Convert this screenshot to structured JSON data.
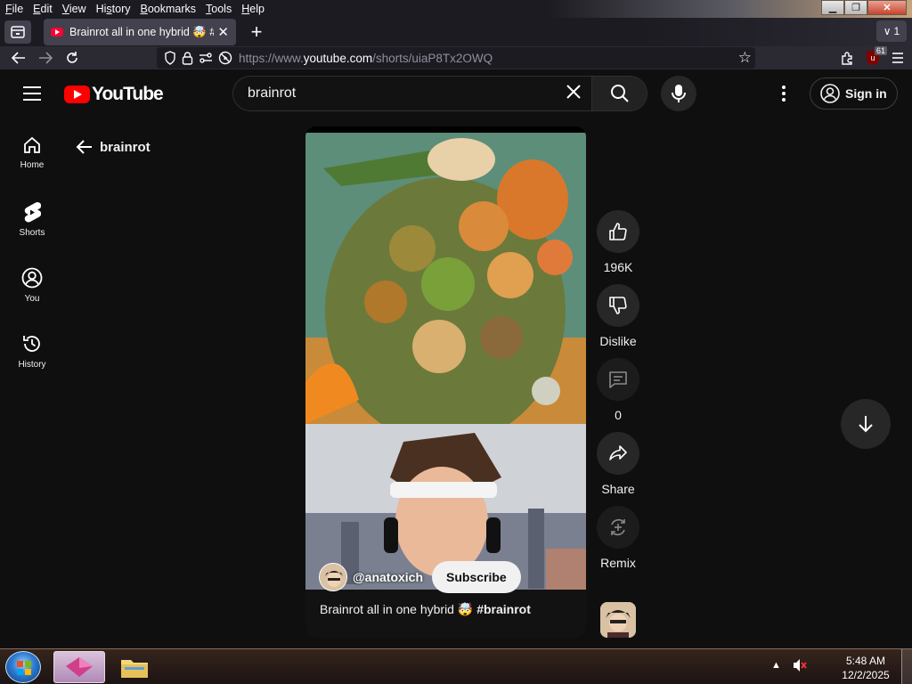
{
  "menubar": {
    "items": [
      {
        "label": "File",
        "ul": "F",
        "rest": "ile"
      },
      {
        "label": "Edit",
        "ul": "E",
        "rest": "dit"
      },
      {
        "label": "View",
        "ul": "V",
        "rest": "iew"
      },
      {
        "label": "History",
        "ul": "s",
        "pre": "Hi",
        "rest": "tory"
      },
      {
        "label": "Bookmarks",
        "ul": "B",
        "rest": "ookmarks"
      },
      {
        "label": "Tools",
        "ul": "T",
        "rest": "ools"
      },
      {
        "label": "Help",
        "ul": "H",
        "rest": "elp"
      }
    ]
  },
  "window_controls": {
    "minimize": "▁",
    "restore": "❐",
    "close": "✕"
  },
  "tabs": {
    "active_title": "Brainrot all in one hybrid 🤯 #br",
    "close_glyph": "✕",
    "new_tab_glyph": "+",
    "list_count": "1",
    "list_glyph": "∨"
  },
  "navbar": {
    "url_prefix": "https://www.",
    "url_host": "youtube.com",
    "url_path": "/shorts/uiaP8Tx2OWQ",
    "ublock_count": "61"
  },
  "youtube": {
    "logo_text": "YouTube",
    "search_query": "brainrot",
    "signin_label": "Sign in",
    "guide": [
      {
        "label": "Home",
        "icon": "home-icon"
      },
      {
        "label": "Shorts",
        "icon": "shorts-icon"
      },
      {
        "label": "You",
        "icon": "you-icon"
      },
      {
        "label": "History",
        "icon": "history-icon"
      }
    ],
    "back_label": "brainrot",
    "short": {
      "channel": "@anatoxich",
      "subscribe_label": "Subscribe",
      "title_text": "Brainrot all in one hybrid 🤯 ",
      "title_tag": "#brainrot"
    },
    "actions": {
      "like_label": "196K",
      "dislike_label": "Dislike",
      "comments_label": "0",
      "share_label": "Share",
      "remix_label": "Remix"
    }
  },
  "taskbar": {
    "time": "5:48 AM",
    "date": "12/2/2025",
    "tray_arrow": "▲"
  }
}
